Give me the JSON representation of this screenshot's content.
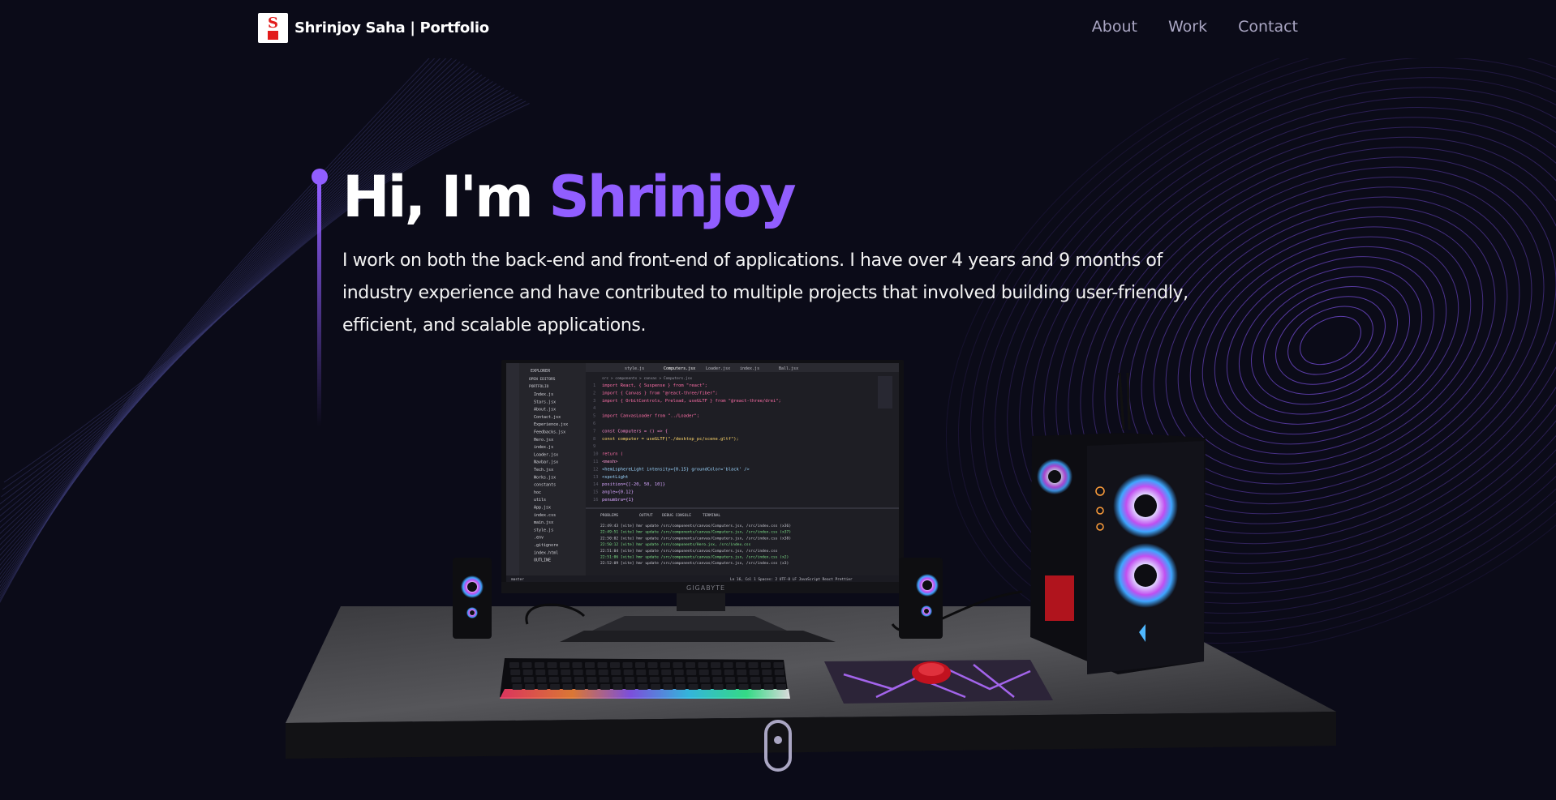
{
  "navbar": {
    "logo_letter": "S",
    "brand": "Shrinjoy Saha | Portfolio",
    "links": [
      {
        "label": "About"
      },
      {
        "label": "Work"
      },
      {
        "label": "Contact"
      }
    ]
  },
  "hero": {
    "greeting": "Hi, I'm ",
    "name": "Shrinjoy",
    "description": "I work on both the back-end and front-end of applications. I have over 4 years and 9 months of industry experience and have contributed to multiple projects that involved building user-friendly, efficient, and scalable applications."
  },
  "scene": {
    "monitor_brand": "GIGABYTE",
    "editor": {
      "explorer_title": "EXPLORER",
      "sections": [
        "OPEN EDITORS",
        "PORTFOLIO"
      ],
      "files": [
        "Index.js",
        "Stars.jsx",
        "About.jsx",
        "Contact.jsx",
        "Experience.jsx",
        "Feedbacks.jsx",
        "Hero.jsx",
        "index.js",
        "Loader.jsx",
        "Navbar.jsx",
        "Tech.jsx",
        "Works.jsx",
        "constants",
        "hoc",
        "utils",
        "App.jsx",
        "index.css",
        "main.jsx",
        "style.js",
        ".env",
        ".gitignore",
        "index.html",
        "OUTLINE"
      ],
      "tabs": [
        "style.js",
        "Computers.jsx",
        "Loader.jsx",
        "index.js",
        "Ball.jsx"
      ],
      "breadcrumb": "src > components > canvas > Computers.jsx",
      "code_lines": [
        "import React, { Suspense } from \"react\";",
        "import { Canvas } from \"@react-three/fiber\";",
        "import { OrbitControls, Preload, useGLTF } from \"@react-three/drei\";",
        "",
        "import CanvasLoader from \"../Loader\";",
        "",
        "const Computers = () => {",
        "  const computer = useGLTF(\"./desktop_pc/scene.gltf\");",
        "",
        "  return (",
        "    <mesh>",
        "      <hemisphereLight intensity={0.15} groundColor='black' />",
        "      <spotLight",
        "        position={[-20, 50, 10]}",
        "        angle={0.12}",
        "        penumbra={1}"
      ],
      "panel_tabs": [
        "PROBLEMS",
        "OUTPUT",
        "DEBUG CONSOLE",
        "TERMINAL"
      ],
      "terminal_lines": [
        "22:49:43 [vite] hmr update /src/components/canvas/Computers.jsx, /src/index.css (x36)",
        "22:49:51 [vite] hmr update /src/components/canvas/Computers.jsx, /src/index.css (x37)",
        "22:50:02 [vite] hmr update /src/components/canvas/Computers.jsx, /src/index.css (x38)",
        "22:50:12 [vite] hmr update /src/components/Hero.jsx, /src/index.css",
        "22:51:04 [vite] hmr update /src/components/canvas/Computers.jsx, /src/index.css",
        "22:51:06 [vite] hmr update /src/components/canvas/Computers.jsx, /src/index.css (x2)",
        "22:52:09 [vite] hmr update /src/components/canvas/Computers.jsx, /src/index.css (x3)"
      ],
      "status_left": "master",
      "status_right": "Ln 16, Col 1   Spaces: 2   UTF-8   LF   JavaScript React   Prettier"
    }
  },
  "colors": {
    "background": "#0b0b18",
    "accent": "#915eff",
    "nav_text": "#aaa6c3"
  }
}
